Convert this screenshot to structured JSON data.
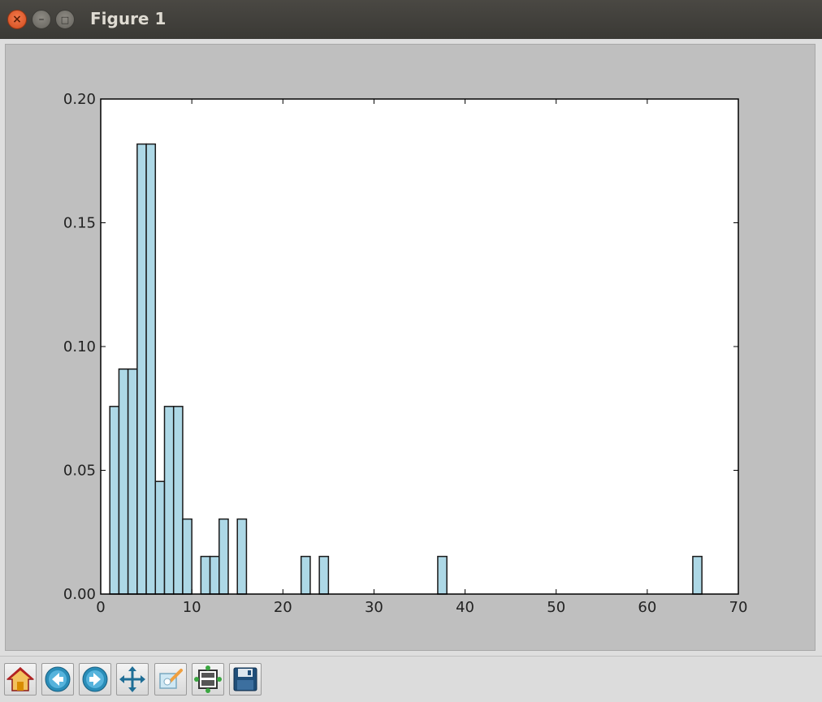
{
  "window": {
    "title": "Figure 1",
    "controls": {
      "close": "×",
      "minimize": "–",
      "maximize": "□"
    }
  },
  "toolbar": {
    "buttons": [
      {
        "name": "home-button",
        "icon": "home-icon"
      },
      {
        "name": "back-button",
        "icon": "back-arrow-icon"
      },
      {
        "name": "forward-button",
        "icon": "forward-arrow-icon"
      },
      {
        "name": "pan-button",
        "icon": "move-icon"
      },
      {
        "name": "zoom-button",
        "icon": "zoom-rect-icon"
      },
      {
        "name": "subplots-button",
        "icon": "configure-subplots-icon"
      },
      {
        "name": "save-button",
        "icon": "save-icon"
      }
    ]
  },
  "colors": {
    "bar_fill": "#add8e6",
    "bar_edge": "#1a1a1a",
    "plot_bg": "#ffffff",
    "figure_bg": "#bfbfbf"
  },
  "chart_data": {
    "type": "bar",
    "xlim": [
      0,
      70
    ],
    "ylim": [
      0,
      0.2
    ],
    "xticks": [
      "0",
      "10",
      "20",
      "30",
      "40",
      "50",
      "60",
      "70"
    ],
    "yticks": [
      "0.00",
      "0.05",
      "0.10",
      "0.15",
      "0.20"
    ],
    "xtick_values": [
      0,
      10,
      20,
      30,
      40,
      50,
      60,
      70
    ],
    "ytick_values": [
      0,
      0.05,
      0.1,
      0.15,
      0.2
    ],
    "bin_width": 1,
    "bars": [
      {
        "x": 1,
        "value": 0.0758
      },
      {
        "x": 2,
        "value": 0.0909
      },
      {
        "x": 3,
        "value": 0.0909
      },
      {
        "x": 4,
        "value": 0.1818
      },
      {
        "x": 5,
        "value": 0.1818
      },
      {
        "x": 6,
        "value": 0.0455
      },
      {
        "x": 7,
        "value": 0.0758
      },
      {
        "x": 8,
        "value": 0.0758
      },
      {
        "x": 9,
        "value": 0.0303
      },
      {
        "x": 11,
        "value": 0.0152
      },
      {
        "x": 12,
        "value": 0.0152
      },
      {
        "x": 13,
        "value": 0.0303
      },
      {
        "x": 15,
        "value": 0.0303
      },
      {
        "x": 22,
        "value": 0.0152
      },
      {
        "x": 24,
        "value": 0.0152
      },
      {
        "x": 37,
        "value": 0.0152
      },
      {
        "x": 65,
        "value": 0.0152
      }
    ],
    "grid": false
  }
}
